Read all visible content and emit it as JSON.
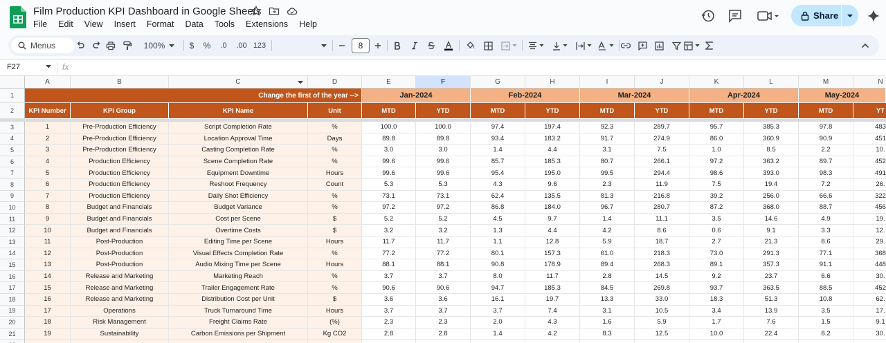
{
  "app": {
    "title": "Film Production KPI Dashboard in Google Sheets",
    "menu": [
      "File",
      "Edit",
      "View",
      "Insert",
      "Format",
      "Data",
      "Tools",
      "Extensions",
      "Help"
    ],
    "share_label": "Share",
    "accent": "#c0561b",
    "month_fill": "#f4b183"
  },
  "toolbar": {
    "menus_label": "Menus",
    "zoom": "100%",
    "currency": "$",
    "percent": "%",
    "dec_decrease": ".0",
    "dec_increase": ".00",
    "number_format": "123",
    "font_size": "8"
  },
  "formula": {
    "cell_ref": "F27",
    "fx": "fx"
  },
  "grid": {
    "columns": [
      "A",
      "B",
      "C",
      "D",
      "E",
      "F",
      "G",
      "H",
      "I",
      "J",
      "K",
      "L",
      "M",
      "N"
    ],
    "selected_column": "F",
    "row_numbers": [
      "1",
      "2",
      "3",
      "4",
      "5",
      "6",
      "7",
      "8",
      "9",
      "10",
      "11",
      "12",
      "13",
      "14",
      "15",
      "16",
      "17",
      "18",
      "19",
      "20",
      "21",
      "22"
    ],
    "caption": "Change the first of the year -->",
    "months": [
      "Jan-2024",
      "Feb-2024",
      "Mar-2024",
      "Apr-2024",
      "May-2024"
    ],
    "headers": [
      "KPI Number",
      "KPI Group",
      "KPI Name",
      "Unit"
    ],
    "sub_headers": [
      "MTD",
      "YTD",
      "MTD",
      "YTD",
      "MTD",
      "YTD",
      "MTD",
      "YTD",
      "MTD",
      "YT"
    ],
    "rows": [
      [
        "1",
        "Pre-Production Efficiency",
        "Script Completion Rate",
        "%",
        "100.0",
        "100.0",
        "97.4",
        "197.4",
        "92.3",
        "289.7",
        "95.7",
        "385.3",
        "97.8",
        "483"
      ],
      [
        "2",
        "Pre-Production Efficiency",
        "Location Approval Time",
        "Days",
        "89.8",
        "89.8",
        "93.4",
        "183.2",
        "91.7",
        "274.9",
        "86.0",
        "360.9",
        "90.9",
        "451"
      ],
      [
        "3",
        "Pre-Production Efficiency",
        "Casting Completion Rate",
        "%",
        "3.0",
        "3.0",
        "1.4",
        "4.4",
        "3.1",
        "7.5",
        "1.0",
        "8.5",
        "2.2",
        "10."
      ],
      [
        "4",
        "Production Efficiency",
        "Scene Completion Rate",
        "%",
        "99.6",
        "99.6",
        "85.7",
        "185.3",
        "80.7",
        "266.1",
        "97.2",
        "363.2",
        "89.7",
        "452"
      ],
      [
        "5",
        "Production Efficiency",
        "Equipment Downtime",
        "Hours",
        "99.6",
        "99.6",
        "95.4",
        "195.0",
        "99.5",
        "294.4",
        "98.6",
        "393.0",
        "98.3",
        "491"
      ],
      [
        "6",
        "Production Efficiency",
        "Reshoot Frequency",
        "Count",
        "5.3",
        "5.3",
        "4.3",
        "9.6",
        "2.3",
        "11.9",
        "7.5",
        "19.4",
        "7.2",
        "26."
      ],
      [
        "7",
        "Production Efficiency",
        "Daily Shot Efficiency",
        "%",
        "73.1",
        "73.1",
        "62.4",
        "135.5",
        "81.3",
        "216.8",
        "39.2",
        "256.0",
        "66.6",
        "322"
      ],
      [
        "8",
        "Budget and Financials",
        "Budget Variance",
        "%",
        "97.2",
        "97.2",
        "86.8",
        "184.0",
        "96.7",
        "280.7",
        "87.2",
        "368.0",
        "88.7",
        "456"
      ],
      [
        "9",
        "Budget and Financials",
        "Cost per Scene",
        "$",
        "5.2",
        "5.2",
        "4.5",
        "9.7",
        "1.4",
        "11.1",
        "3.5",
        "14.6",
        "4.9",
        "19."
      ],
      [
        "10",
        "Budget and Financials",
        "Overtime Costs",
        "$",
        "3.2",
        "3.2",
        "1.3",
        "4.4",
        "4.2",
        "8.6",
        "0.6",
        "9.1",
        "3.3",
        "12."
      ],
      [
        "11",
        "Post-Production",
        "Editing Time per Scene",
        "Hours",
        "11.7",
        "11.7",
        "1.1",
        "12.8",
        "5.9",
        "18.7",
        "2.7",
        "21.3",
        "8.6",
        "29."
      ],
      [
        "12",
        "Post-Production",
        "Visual Effects Completion Rate",
        "%",
        "77.2",
        "77.2",
        "80.1",
        "157.3",
        "61.0",
        "218.3",
        "73.0",
        "291.3",
        "77.1",
        "368"
      ],
      [
        "13",
        "Post-Production",
        "Audio Mixing Time per Scene",
        "Hours",
        "88.1",
        "88.1",
        "90.8",
        "178.9",
        "89.4",
        "268.3",
        "89.1",
        "357.3",
        "91.1",
        "448"
      ],
      [
        "14",
        "Release and Marketing",
        "Marketing Reach",
        "%",
        "3.7",
        "3.7",
        "8.0",
        "11.7",
        "2.8",
        "14.5",
        "9.2",
        "23.7",
        "6.6",
        "30."
      ],
      [
        "15",
        "Release and Marketing",
        "Trailer Engagement Rate",
        "%",
        "90.6",
        "90.6",
        "94.7",
        "185.3",
        "84.5",
        "269.8",
        "93.7",
        "363.5",
        "88.5",
        "452"
      ],
      [
        "16",
        "Release and Marketing",
        "Distribution Cost per Unit",
        "$",
        "3.6",
        "3.6",
        "16.1",
        "19.7",
        "13.3",
        "33.0",
        "18.3",
        "51.3",
        "10.8",
        "62."
      ],
      [
        "17",
        "Operations",
        "Truck Turnaround Time",
        "Hours",
        "3.7",
        "3.7",
        "3.7",
        "7.4",
        "3.1",
        "10.5",
        "3.4",
        "13.9",
        "3.5",
        "17."
      ],
      [
        "18",
        "Risk Management",
        "Freight Claims Rate",
        "(%)",
        "2.3",
        "2.3",
        "2.0",
        "4.3",
        "1.6",
        "5.9",
        "1.7",
        "7.6",
        "1.5",
        "9.1"
      ],
      [
        "19",
        "Sustainability",
        "Carbon Emissions per Shipment",
        "Kg CO2",
        "2.8",
        "2.8",
        "1.4",
        "4.2",
        "8.3",
        "12.5",
        "10.0",
        "22.4",
        "8.2",
        "30."
      ]
    ]
  }
}
